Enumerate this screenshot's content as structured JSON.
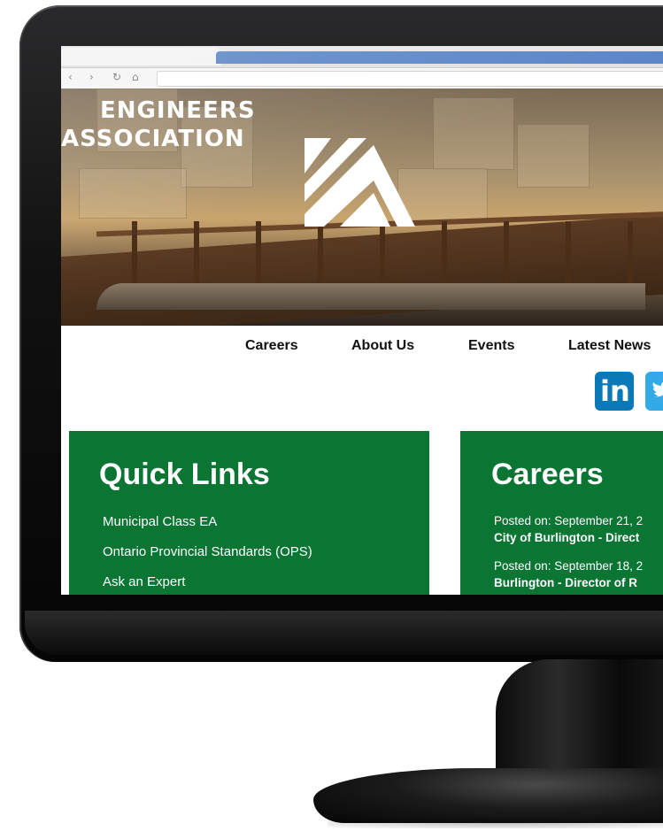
{
  "site": {
    "logo_line1": "ENGINEERS",
    "logo_line2": "ASSOCIATION"
  },
  "nav": {
    "items": [
      {
        "label": "Careers"
      },
      {
        "label": "About Us"
      },
      {
        "label": "Events"
      },
      {
        "label": "Latest News"
      }
    ]
  },
  "social": {
    "linkedin_icon": "linkedin-icon",
    "twitter_icon": "twitter-icon",
    "linkedin_label": "in"
  },
  "quick_links": {
    "title": "Quick Links",
    "links": [
      {
        "label": "Municipal Class EA"
      },
      {
        "label": "Ontario Provincial Standards (OPS)"
      },
      {
        "label": "Ask an Expert"
      }
    ]
  },
  "careers": {
    "title": "Careers",
    "posts": [
      {
        "meta": "Posted on: September 21, 2",
        "title": "City of Burlington - Direct"
      },
      {
        "meta": "Posted on: September 18, 2",
        "title": "Burlington - Director of R"
      }
    ]
  },
  "colors": {
    "panel_green": "#0b7534",
    "linkedin_blue": "#0b79b8",
    "twitter_blue": "#33a9e8",
    "browser_tab_blue": "#5b86c8"
  }
}
